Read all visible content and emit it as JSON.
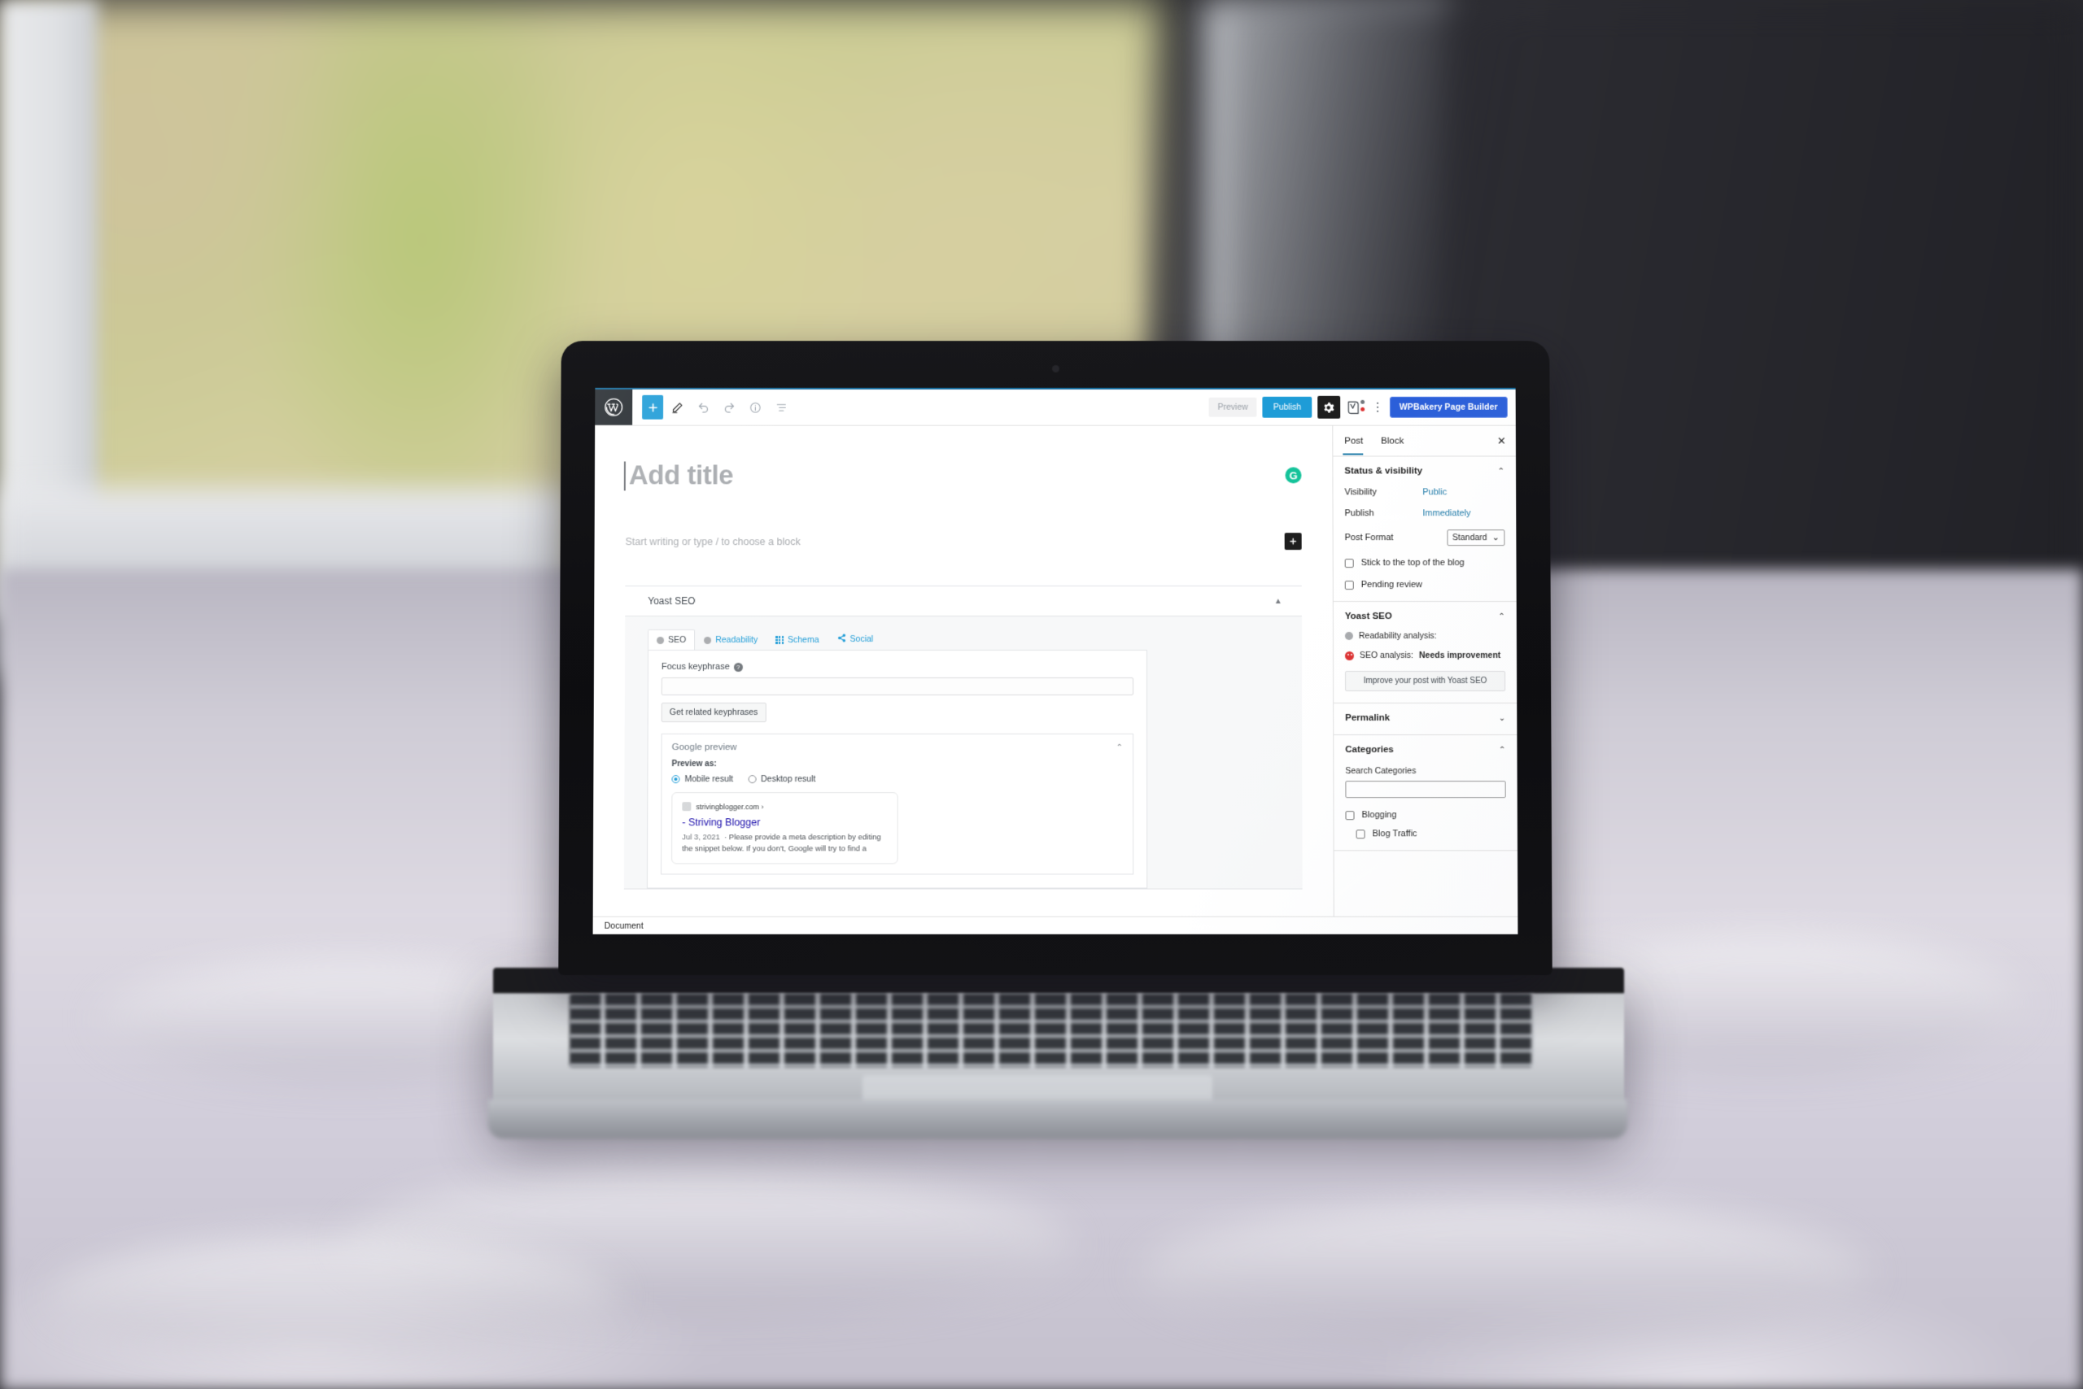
{
  "app": {
    "name": "WordPress Block Editor",
    "logo_icon": "wordpress-logo-icon"
  },
  "toolbar": {
    "add_block_label": "+",
    "add_block_icon": "plus-icon",
    "tools_icon": "pencil-icon",
    "undo_icon": "undo-arrow-icon",
    "redo_icon": "redo-arrow-icon",
    "details_icon": "info-circle-icon",
    "list_view_icon": "list-view-icon",
    "preview_label": "Preview",
    "publish_label": "Publish",
    "settings_icon": "gear-icon",
    "yoast_icon": "yoast-seo-icon",
    "options_icon": "kebab-menu-icon",
    "wpbakery_label": "WPBakery Page Builder"
  },
  "editor": {
    "title_placeholder": "Add title",
    "paragraph_placeholder": "Start writing or type / to choose a block",
    "grammarly_icon": "grammarly-icon",
    "grammarly_glyph": "G",
    "block_insert_icon": "plus-icon"
  },
  "yoast_metabox": {
    "title": "Yoast SEO",
    "collapse_icon": "chevron-up-icon",
    "tabs": [
      {
        "label": "SEO",
        "icon": "seo-score-bullet-icon",
        "active": true
      },
      {
        "label": "Readability",
        "icon": "readability-score-bullet-icon",
        "active": false
      },
      {
        "label": "Schema",
        "icon": "schema-grid-icon",
        "active": false
      },
      {
        "label": "Social",
        "icon": "share-nodes-icon",
        "active": false
      }
    ],
    "focus_keyphrase": {
      "label": "Focus keyphrase",
      "help_icon": "question-mark-icon",
      "help_glyph": "?",
      "value": "",
      "related_button": "Get related keyphrases"
    },
    "google_preview": {
      "title": "Google preview",
      "collapse_icon": "chevron-up-icon",
      "preview_as_label": "Preview as:",
      "options": [
        {
          "label": "Mobile result",
          "selected": true
        },
        {
          "label": "Desktop result",
          "selected": false
        }
      ],
      "snippet": {
        "favicon": "site-favicon-icon",
        "url": "strivingblogger.com ›",
        "title": "- Striving Blogger",
        "date": "Jul 3, 2021",
        "description": "Please provide a meta description by editing the snippet below. If you don't, Google will try to find a"
      }
    }
  },
  "sidebar": {
    "tabs": [
      {
        "label": "Post",
        "active": true
      },
      {
        "label": "Block",
        "active": false
      }
    ],
    "close_icon": "close-icon",
    "close_glyph": "✕",
    "status_visibility": {
      "title": "Status & visibility",
      "collapse_icon": "chevron-up-icon",
      "rows": [
        {
          "label": "Visibility",
          "value": "Public"
        },
        {
          "label": "Publish",
          "value": "Immediately"
        }
      ],
      "post_format": {
        "label": "Post Format",
        "value": "Standard",
        "icon": "chevron-down-icon"
      },
      "checkboxes": [
        {
          "label": "Stick to the top of the blog",
          "checked": false
        },
        {
          "label": "Pending review",
          "checked": false
        }
      ]
    },
    "yoast_seo": {
      "title": "Yoast SEO",
      "collapse_icon": "chevron-up-icon",
      "readability": {
        "label": "Readability analysis:",
        "value": "",
        "icon": "grey-bullet-icon"
      },
      "seo": {
        "label": "SEO analysis:",
        "value": "Needs improvement",
        "icon": "red-frown-icon"
      },
      "improve_button": "Improve your post with Yoast SEO"
    },
    "permalink": {
      "title": "Permalink",
      "collapse_icon": "chevron-down-icon"
    },
    "categories": {
      "title": "Categories",
      "collapse_icon": "chevron-up-icon",
      "search_label": "Search Categories",
      "search_value": "",
      "items": [
        {
          "label": "Blogging",
          "checked": false,
          "indent": false
        },
        {
          "label": "Blog Traffic",
          "checked": false,
          "indent": true
        }
      ]
    }
  },
  "statusbar": {
    "label": "Document"
  },
  "colors": {
    "wp_blue": "#1e9cd7",
    "wp_dark": "#23282d",
    "wpbakery_blue": "#2b5fd9",
    "link_blue": "#1e7aa8",
    "grammarly_green": "#15c39a",
    "error_red": "#dc3232",
    "serp_title_blue": "#1a0dab"
  }
}
